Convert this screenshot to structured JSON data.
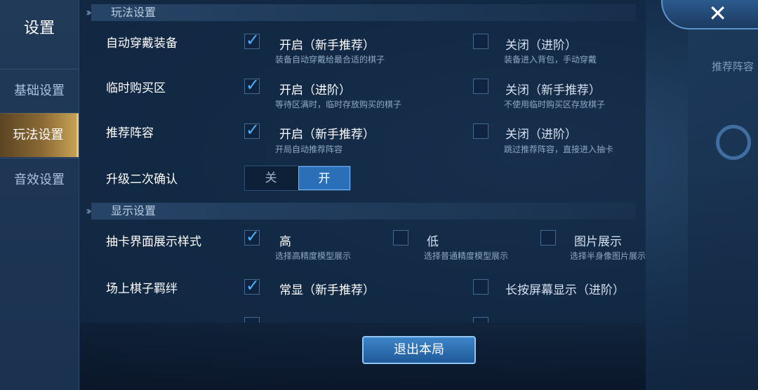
{
  "sidebar": {
    "title": "设置",
    "items": [
      {
        "label": "基础设置"
      },
      {
        "label": "玩法设置"
      },
      {
        "label": "音效设置"
      }
    ]
  },
  "background": {
    "recommend_label": "推荐阵容"
  },
  "sections": {
    "gameplay": "玩法设置",
    "display": "显示设置"
  },
  "rows": {
    "auto_equip": {
      "label": "自动穿戴装备",
      "on": {
        "title": "开启（新手推荐）",
        "desc": "装备自动穿戴给最合适的棋子"
      },
      "off": {
        "title": "关闭（进阶）",
        "desc": "装备进入背包，手动穿戴"
      }
    },
    "temp_buy": {
      "label": "临时购买区",
      "on": {
        "title": "开启（进阶）",
        "desc": "等待区满时，临时存放购买的棋子"
      },
      "off": {
        "title": "关闭（新手推荐）",
        "desc": "不使用临时购买区存放棋子"
      }
    },
    "recommend": {
      "label": "推荐阵容",
      "on": {
        "title": "开启（新手推荐）",
        "desc": "开局自动推荐阵容"
      },
      "off": {
        "title": "关闭（进阶）",
        "desc": "跳过推荐阵容，直接进入抽卡"
      }
    },
    "upgrade_confirm": {
      "label": "升级二次确认",
      "off_label": "关",
      "on_label": "开"
    },
    "draw_style": {
      "label": "抽卡界面展示样式",
      "high": {
        "title": "高",
        "desc": "选择高精度模型展示"
      },
      "low": {
        "title": "低",
        "desc": "选择普通精度模型展示"
      },
      "image": {
        "title": "图片展示",
        "desc": "选择半身像图片展示"
      }
    },
    "bond": {
      "label": "场上棋子羁绊",
      "always": {
        "title": "常显（新手推荐）"
      },
      "press": {
        "title": "长按屏幕显示（进阶）"
      }
    }
  },
  "quit_label": "退出本局",
  "accent_color": "#4fb0ff"
}
